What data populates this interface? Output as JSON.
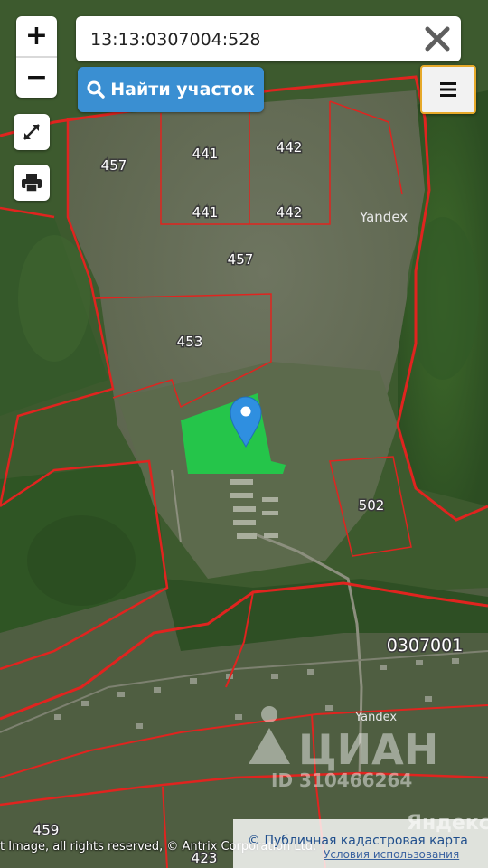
{
  "search": {
    "value": "13:13:0307004:528",
    "find_label": "Найти участок"
  },
  "controls": {
    "zoom_in": "+",
    "zoom_out": "−"
  },
  "map": {
    "parcel_labels": [
      "457",
      "441",
      "442",
      "441",
      "442",
      "457",
      "453",
      "502",
      "459",
      "423"
    ],
    "quarter_label": "0307001",
    "yandex_label_1": "Yandex",
    "yandex_label_2": "Yandex",
    "watermark_brand": "ЦИАН",
    "watermark_id": "ID 310466264",
    "yandex_brand": "Яндекс",
    "boundary_color": "#e0241f",
    "selected_parcel_color": "#1fcf4a",
    "marker_color": "#2f8fe0"
  },
  "footer": {
    "copyright": "t Image, all rights reserved, © Antrix Corporation Ltd.",
    "attribution": "© Публичная кадастровая карта",
    "terms": "Условия использования"
  }
}
